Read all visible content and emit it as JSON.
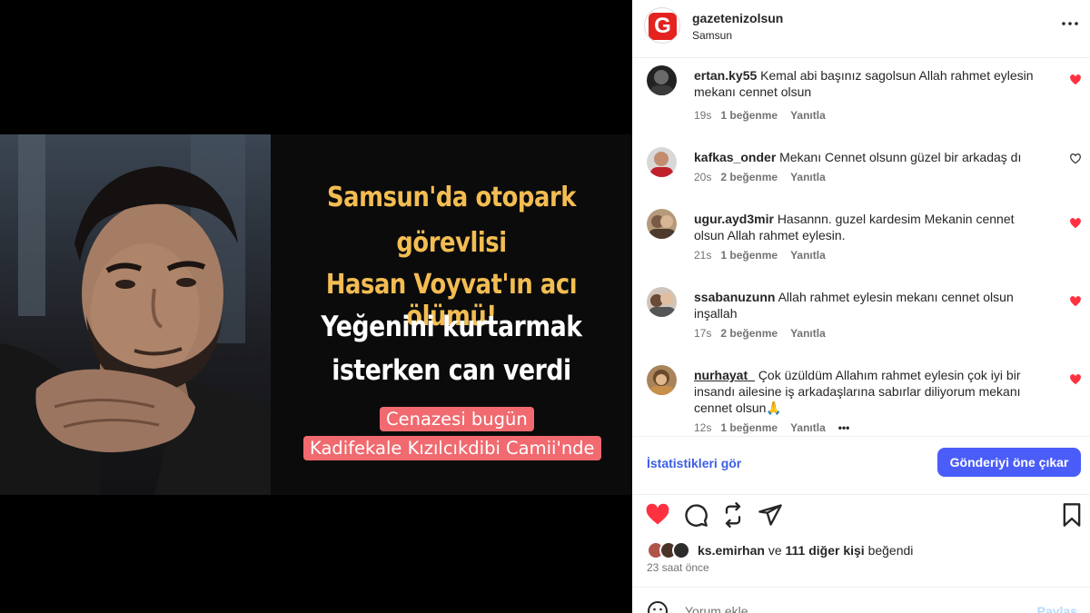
{
  "post": {
    "headline": {
      "line1": "Samsun'da otopark",
      "line2": "görevlisi",
      "line3": "Hasan Voyvat'ın acı ölümü!",
      "line4": "Yeğenini kurtarmak",
      "line5": "isterken can verdi",
      "red1": "Cenazesi bugün",
      "red2": "Kadifekale Kızılcıkdibi Camii'nde"
    }
  },
  "header": {
    "account": "gazetenizolsun",
    "location": "Samsun",
    "more_icon": "more-horizontal-icon"
  },
  "comments": [
    {
      "user": "ertan.ky55",
      "text": "Kemal abi başınız sagolsun Allah rahmet eylesin mekanı cennet olsun",
      "time": "19s",
      "likes": "1 beğenme",
      "reply": "Yanıtla",
      "liked": true
    },
    {
      "user": "kafkas_onder",
      "text": "Mekanı Cennet olsunn güzel bir arkadaş dı",
      "time": "20s",
      "likes": "2 beğenme",
      "reply": "Yanıtla",
      "liked": false
    },
    {
      "user": "ugur.ayd3mir",
      "text": "Hasannn. guzel kardesim Mekanin cennet olsun Allah rahmet eylesin.",
      "time": "21s",
      "likes": "1 beğenme",
      "reply": "Yanıtla",
      "liked": true
    },
    {
      "user": "ssabanuzunn",
      "text": "Allah rahmet eylesin mekanı cennet olsun inşallah",
      "time": "17s",
      "likes": "2 beğenme",
      "reply": "Yanıtla",
      "liked": true
    },
    {
      "user": "nurhayat_",
      "text": "Çok üzüldüm Allahım rahmet eylesin çok iyi bir insandı ailesine iş arkadaşlarına sabırlar diliyorum mekanı cennet olsun🙏",
      "time": "12s",
      "likes": "1 beğenme",
      "reply": "Yanıtla",
      "more": "•••",
      "liked": true
    }
  ],
  "actions": {
    "insights": "İstatistikleri gör",
    "boost": "Gönderiyi öne çıkar"
  },
  "likes": {
    "user": "ks.emirhan",
    "connector": "ve",
    "others": "111 diğer kişi",
    "suffix": "beğendi"
  },
  "time_ago": "23 saat önce",
  "comment_box": {
    "placeholder": "Yorum ekle...",
    "post_label": "Paylaş"
  },
  "colors": {
    "like_red": "#ff3040",
    "accent_blue": "#4a5df9",
    "headline_yellow": "#f3bd52",
    "headline_red_bg": "#f06a6f"
  }
}
